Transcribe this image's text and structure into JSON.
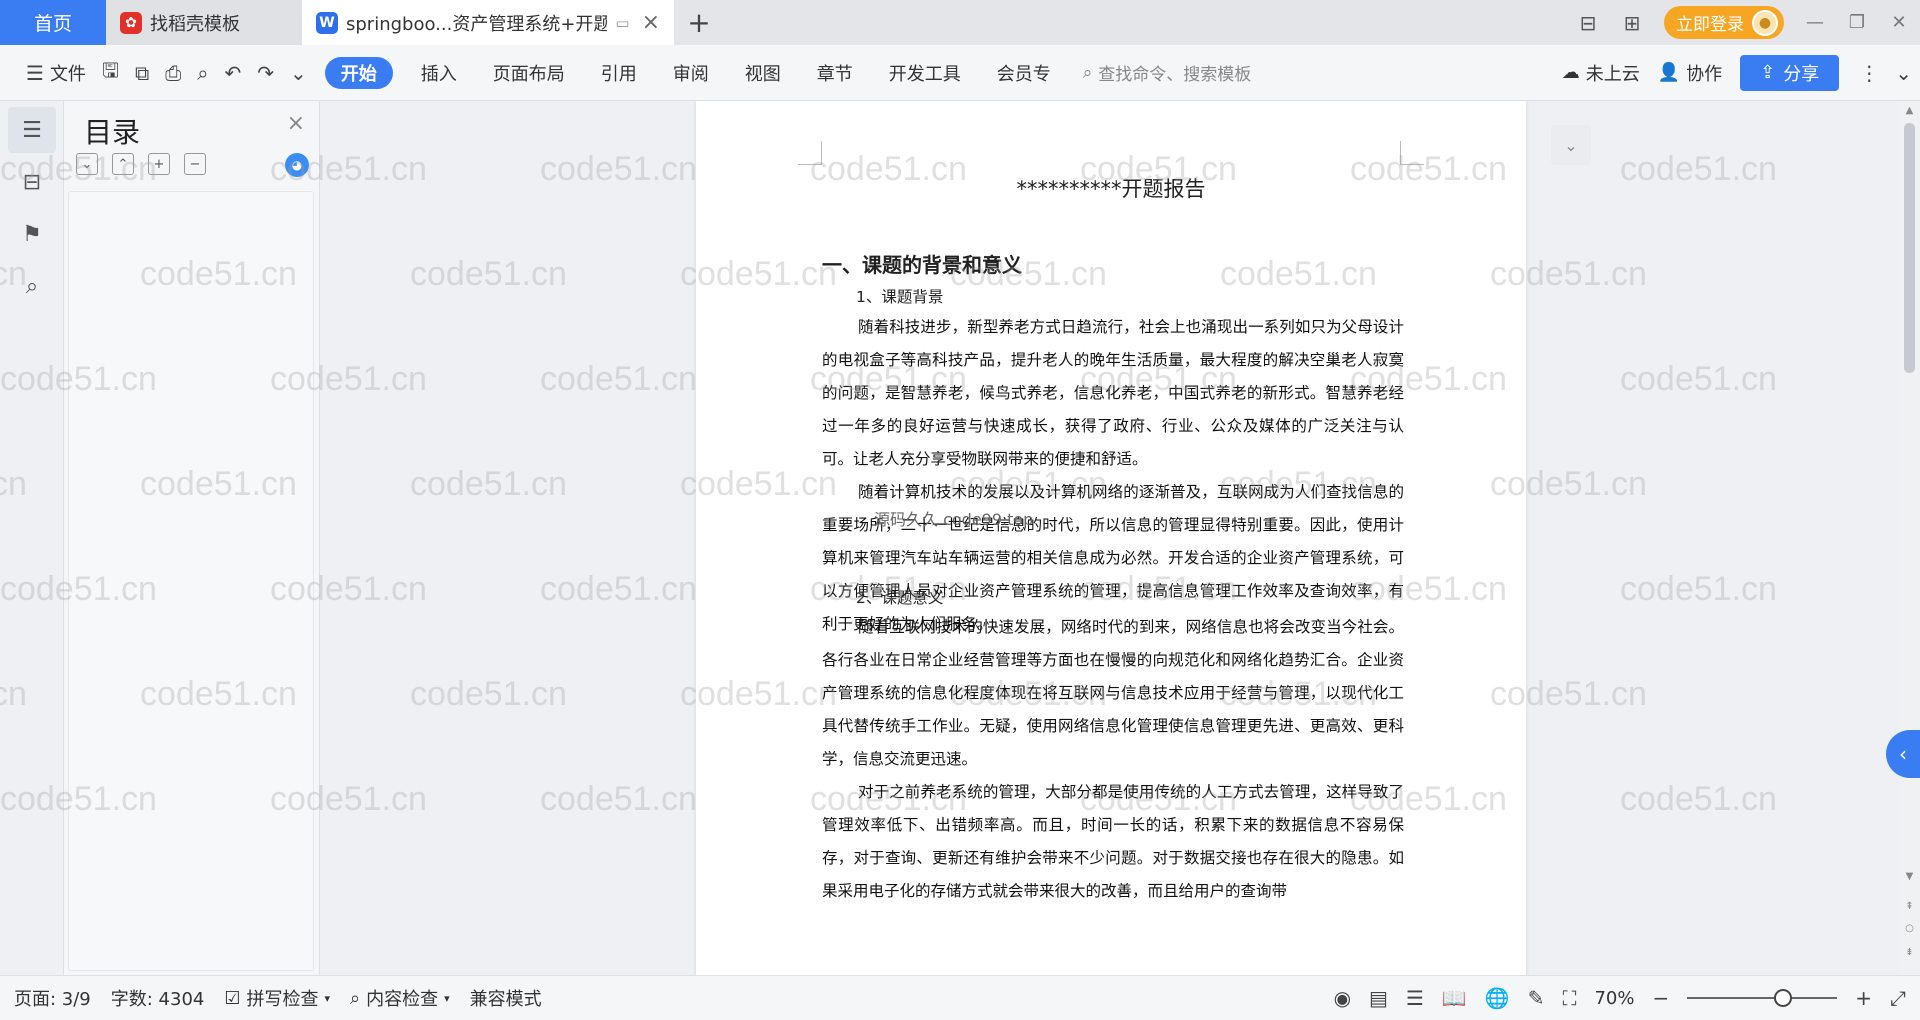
{
  "tabs": {
    "home": "首页",
    "template": "找稻壳模板",
    "document": "springboo...资产管理系统+开题",
    "add": "+"
  },
  "header": {
    "login": "立即登录"
  },
  "toolbar": {
    "file": "文件",
    "menu_tabs": [
      "开始",
      "插入",
      "页面布局",
      "引用",
      "审阅",
      "视图",
      "章节",
      "开发工具",
      "会员专"
    ],
    "search_placeholder": "查找命令、搜索模板",
    "cloud": "未上云",
    "collab": "协作",
    "share": "分享"
  },
  "toc": {
    "title": "目录"
  },
  "document": {
    "title": "**********开题报告",
    "heading1": "一、课题的背景和意义",
    "sub1": "1、课题背景",
    "para1": "随着科技进步，新型养老方式日趋流行，社会上也涌现出一系列如只为父母设计的电视盒子等高科技产品，提升老人的晚年生活质量，最大程度的解决空巢老人寂寞的问题，是智慧养老，候鸟式养老，信息化养老，中国式养老的新形式。智慧养老经过一年多的良好运营与快速成长，获得了政府、行业、公众及媒体的广泛关注与认可。让老人充分享受物联网带来的便捷和舒适。",
    "para2": "随着计算机技术的发展以及计算机网络的逐渐普及，互联网成为人们查找信息的重要场所，二十一世纪是信息的时代，所以信息的管理显得特别重要。因此，使用计算机来管理汽车站车辆运营的相关信息成为必然。开发合适的企业资产管理系统，可以方便管理人员对企业资产管理系统的管理，提高信息管理工作效率及查询效率，有利于更好的为人们服务。",
    "sub2": "2、课题意义",
    "para3": "随着互联网技术的快速发展，网络时代的到来，网络信息也将会改变当今社会。各行各业在日常企业经营管理等方面也在慢慢的向规范化和网络化趋势汇合。企业资产管理系统的信息化程度体现在将互联网与信息技术应用于经营与管理，以现代化工具代替传统手工作业。无疑，使用网络信息化管理使信息管理更先进、更高效、更科学，信息交流更迅速。",
    "para4": "对于之前养老系统的管理，大部分都是使用传统的人工方式去管理，这样导致了管理效率低下、出错频率高。而且，时间一长的话，积累下来的数据信息不容易保存，对于查询、更新还有维护会带来不少问题。对于数据交接也存在很大的隐患。如果采用电子化的存储方式就会带来很大的改善，而且给用户的查询带",
    "inner_watermark": "源码久久 code99.top"
  },
  "watermark": {
    "text": "code51.cn"
  },
  "status": {
    "page": "页面: 3/9",
    "words": "字数: 4304",
    "spell": "拼写检查",
    "content_check": "内容检查",
    "compat": "兼容模式",
    "zoom": "70%",
    "zoom_fraction": 0.7
  }
}
